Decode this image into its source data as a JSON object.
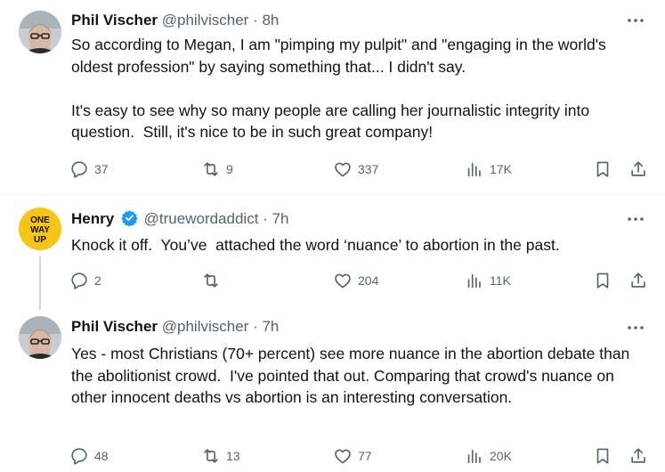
{
  "tweets": [
    {
      "name": "Phil Vischer",
      "handle": "@philvischer",
      "separator": "·",
      "time": "8h",
      "text": "So according to Megan, I am \"pimping my pulpit\" and \"engaging in the world's oldest profession\" by saying something that... I didn't say.\n\nIt's easy to see why so many people are calling her journalistic integrity into question.  Still, it's nice to be in such great company!",
      "replies": "37",
      "reposts": "9",
      "likes": "337",
      "views": "17K"
    },
    {
      "name": "Henry",
      "handle": "@truewordaddict",
      "separator": "·",
      "time": "7h",
      "avatar_text": [
        "ONE",
        "WAY",
        "UP"
      ],
      "text": "Knock it off.  You’ve  attached the word ‘nuance’ to abortion in the past.",
      "replies": "2",
      "reposts": "",
      "likes": "204",
      "views": "11K"
    },
    {
      "name": "Phil Vischer",
      "handle": "@philvischer",
      "separator": "·",
      "time": "7h",
      "text": "Yes - most Christians (70+ percent) see more nuance in the abortion debate than the abolitionist crowd.  I've pointed that out. Comparing that crowd's nuance on other innocent deaths vs abortion is an interesting conversation.",
      "replies": "48",
      "reposts": "13",
      "likes": "77",
      "views": "20K"
    }
  ],
  "colors": {
    "text": "#0f1419",
    "muted": "#536471",
    "verified": "#1d9bf0",
    "thread_line": "#cfd9de",
    "henry_avatar_bg": "#f5c518"
  },
  "icons": [
    "reply-icon",
    "repost-icon",
    "like-icon",
    "views-icon",
    "bookmark-icon",
    "share-icon",
    "more-icon",
    "verified-icon"
  ]
}
